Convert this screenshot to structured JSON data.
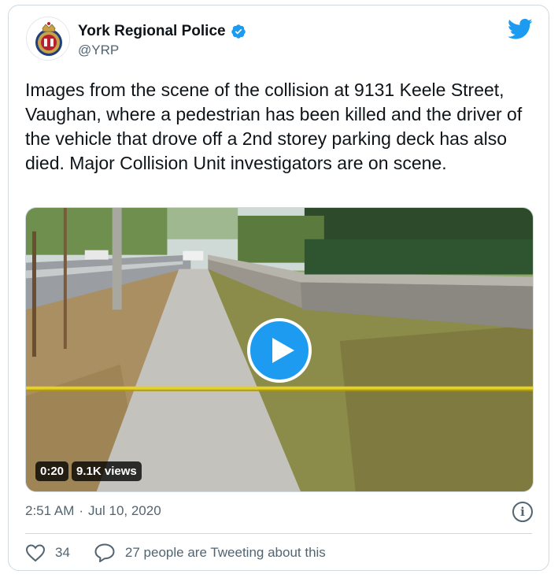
{
  "author": {
    "name": "York Regional Police",
    "handle": "@YRP",
    "avatar_icon": "police-badge-icon",
    "verified_icon": "verified-badge-icon"
  },
  "platform_icon": "twitter-bird-icon",
  "tweet": {
    "text": "Images from the scene of the collision at 9131 Keele Street, Vaughan, where a pedestrian has been killed and the driver of the vehicle that drove off a 2nd storey parking deck has also died. Major Collision Unit investigators are on scene."
  },
  "media": {
    "duration": "0:20",
    "views": "9.1K views",
    "play_icon": "play-icon"
  },
  "meta": {
    "time": "2:51 AM",
    "separator": "·",
    "date": "Jul 10, 2020",
    "info_icon": "info-icon"
  },
  "engagement": {
    "likes": "34",
    "conversation": "27 people are Tweeting about this",
    "like_icon": "heart-icon",
    "reply_icon": "speech-bubble-icon"
  },
  "colors": {
    "accent": "#1d9bf0",
    "text": "#0f1419",
    "muted": "#536471",
    "border": "#cfd9de"
  }
}
